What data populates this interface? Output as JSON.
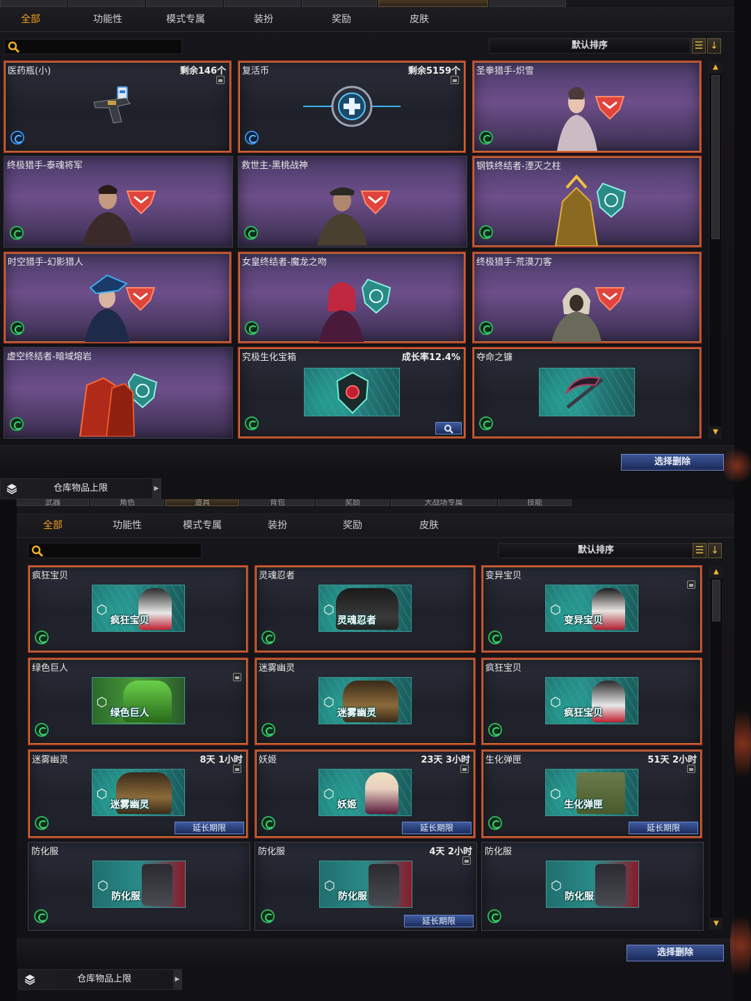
{
  "panel1": {
    "tabs": [
      "全部",
      "功能性",
      "模式专属",
      "装扮",
      "奖励",
      "皮肤"
    ],
    "active_tab": "全部",
    "sort_label": "默认排序",
    "items": [
      {
        "name": "医药瓶(小)",
        "count": "剩余146个"
      },
      {
        "name": "复活币",
        "count": "剩余5159个"
      },
      {
        "name": "圣拳猎手-炽雪",
        "count": ""
      },
      {
        "name": "终极猎手-泰魂将军",
        "count": ""
      },
      {
        "name": "救世主-黑桃战神",
        "count": ""
      },
      {
        "name": "钢铁终结者-湮灭之柱",
        "count": ""
      },
      {
        "name": "时空猎手-幻影猎人",
        "count": ""
      },
      {
        "name": "女皇终结者-魔龙之吻",
        "count": ""
      },
      {
        "name": "终极猎手-荒漠刀客",
        "count": ""
      },
      {
        "name": "虚空终结者-暗域熔岩",
        "count": ""
      },
      {
        "name": "究极生化宝箱",
        "count": "成长率12.4%"
      },
      {
        "name": "夺命之镰",
        "count": ""
      }
    ],
    "delete_label": "选择删除",
    "storage_label": "仓库物品上限"
  },
  "panel2": {
    "top_tabs": [
      "武器",
      "角色",
      "道具",
      "背包",
      "奖励",
      "大战场专属",
      "技能"
    ],
    "tabs": [
      "全部",
      "功能性",
      "模式专属",
      "装扮",
      "奖励",
      "皮肤"
    ],
    "active_tab": "全部",
    "sort_label": "默认排序",
    "items": [
      {
        "name": "疯狂宝贝",
        "time": "",
        "tile_label": "疯狂宝贝"
      },
      {
        "name": "灵魂忍者",
        "time": "",
        "tile_label": "灵魂忍者"
      },
      {
        "name": "变异宝贝",
        "time": "",
        "tile_label": "变异宝贝"
      },
      {
        "name": "绿色巨人",
        "time": "",
        "tile_label": "绿色巨人"
      },
      {
        "name": "迷雾幽灵",
        "time": "",
        "tile_label": "迷雾幽灵"
      },
      {
        "name": "疯狂宝贝",
        "time": "",
        "tile_label": "疯狂宝贝"
      },
      {
        "name": "迷雾幽灵",
        "time": "8天 1小时",
        "tile_label": "迷雾幽灵",
        "extend": "延长期限"
      },
      {
        "name": "妖姬",
        "time": "23天 3小时",
        "tile_label": "妖姬",
        "extend": "延长期限"
      },
      {
        "name": "生化弹匣",
        "time": "51天 2小时",
        "tile_label": "生化弹匣",
        "extend": "延长期限"
      },
      {
        "name": "防化服",
        "time": "",
        "tile_label": "防化服"
      },
      {
        "name": "防化服",
        "time": "4天 2小时",
        "tile_label": "防化服",
        "extend": "延长期限"
      },
      {
        "name": "防化服",
        "time": "",
        "tile_label": "防化服"
      }
    ],
    "delete_label": "选择删除",
    "storage_label": "仓库物品上限"
  },
  "colors": {
    "active_tab": "#f0a020",
    "highlight_border": "#b5452a",
    "button_blue": "#3c5596",
    "badge_green": "#2fb15c"
  }
}
